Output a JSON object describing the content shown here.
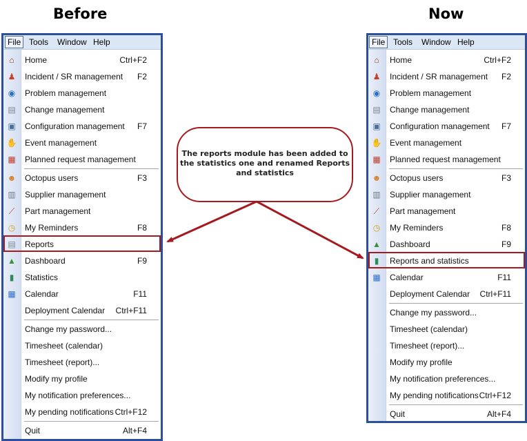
{
  "headings": {
    "before": "Before",
    "now": "Now"
  },
  "menubar": [
    "File",
    "Tools",
    "Window",
    "Help"
  ],
  "callout": "The reports module has been added to the statistics one and renamed Reports and statistics",
  "before_menu": [
    {
      "label": "Home",
      "shortcut": "Ctrl+F2",
      "icon": "home-icon"
    },
    {
      "label": "Incident / SR management",
      "shortcut": "F2",
      "icon": "incident-icon"
    },
    {
      "label": "Problem management",
      "shortcut": "",
      "icon": "problem-icon"
    },
    {
      "label": "Change management",
      "shortcut": "",
      "icon": "change-icon"
    },
    {
      "label": "Configuration management",
      "shortcut": "F7",
      "icon": "configuration-icon"
    },
    {
      "label": "Event management",
      "shortcut": "",
      "icon": "event-icon"
    },
    {
      "label": "Planned request management",
      "shortcut": "",
      "icon": "calendar-12-icon"
    },
    {
      "sep": true
    },
    {
      "label": "Octopus users",
      "shortcut": "F3",
      "icon": "users-icon"
    },
    {
      "label": "Supplier management",
      "shortcut": "",
      "icon": "supplier-icon"
    },
    {
      "label": "Part management",
      "shortcut": "",
      "icon": "part-icon"
    },
    {
      "label": "My Reminders",
      "shortcut": "F8",
      "icon": "reminder-icon"
    },
    {
      "label": "Reports",
      "shortcut": "",
      "icon": "report-icon",
      "highlight": true
    },
    {
      "label": "Dashboard",
      "shortcut": "F9",
      "icon": "dashboard-icon"
    },
    {
      "label": "Statistics",
      "shortcut": "",
      "icon": "statistics-icon"
    },
    {
      "label": "Calendar",
      "shortcut": "F11",
      "icon": "calendar-icon"
    },
    {
      "label": "Deployment Calendar",
      "shortcut": "Ctrl+F11",
      "icon": ""
    },
    {
      "sep": true
    },
    {
      "label": "Change my password...",
      "shortcut": "",
      "icon": ""
    },
    {
      "label": "Timesheet (calendar)",
      "shortcut": "",
      "icon": ""
    },
    {
      "label": "Timesheet (report)...",
      "shortcut": "",
      "icon": ""
    },
    {
      "label": "Modify my profile",
      "shortcut": "",
      "icon": ""
    },
    {
      "label": "My notification preferences...",
      "shortcut": "",
      "icon": ""
    },
    {
      "label": "My pending notifications",
      "shortcut": "Ctrl+F12",
      "icon": ""
    },
    {
      "sep": true
    },
    {
      "label": "Quit",
      "shortcut": "Alt+F4",
      "icon": ""
    }
  ],
  "now_menu": [
    {
      "label": "Home",
      "shortcut": "Ctrl+F2",
      "icon": "home-icon"
    },
    {
      "label": "Incident / SR management",
      "shortcut": "F2",
      "icon": "incident-icon"
    },
    {
      "label": "Problem management",
      "shortcut": "",
      "icon": "problem-icon"
    },
    {
      "label": "Change management",
      "shortcut": "",
      "icon": "change-icon"
    },
    {
      "label": "Configuration management",
      "shortcut": "F7",
      "icon": "configuration-icon"
    },
    {
      "label": "Event management",
      "shortcut": "",
      "icon": "event-icon"
    },
    {
      "label": "Planned request management",
      "shortcut": "",
      "icon": "calendar-12-icon"
    },
    {
      "sep": true
    },
    {
      "label": "Octopus users",
      "shortcut": "F3",
      "icon": "users-icon"
    },
    {
      "label": "Supplier management",
      "shortcut": "",
      "icon": "supplier-icon"
    },
    {
      "label": "Part management",
      "shortcut": "",
      "icon": "part-icon"
    },
    {
      "label": "My Reminders",
      "shortcut": "F8",
      "icon": "reminder-icon"
    },
    {
      "label": "Dashboard",
      "shortcut": "F9",
      "icon": "dashboard-icon"
    },
    {
      "label": "Reports and statistics",
      "shortcut": "",
      "icon": "statistics-icon",
      "highlight": true
    },
    {
      "label": "Calendar",
      "shortcut": "F11",
      "icon": "calendar-icon"
    },
    {
      "label": "Deployment Calendar",
      "shortcut": "Ctrl+F11",
      "icon": ""
    },
    {
      "sep": true
    },
    {
      "label": "Change my password...",
      "shortcut": "",
      "icon": ""
    },
    {
      "label": "Timesheet (calendar)",
      "shortcut": "",
      "icon": ""
    },
    {
      "label": "Timesheet (report)...",
      "shortcut": "",
      "icon": ""
    },
    {
      "label": "Modify my profile",
      "shortcut": "",
      "icon": ""
    },
    {
      "label": "My notification preferences...",
      "shortcut": "",
      "icon": ""
    },
    {
      "label": "My pending notifications",
      "shortcut": "Ctrl+F12",
      "icon": ""
    },
    {
      "sep": true
    },
    {
      "label": "Quit",
      "shortcut": "Alt+F4",
      "icon": ""
    }
  ],
  "colors": {
    "window_border": "#2b4f9a",
    "highlight": "#a51a1f",
    "menubar": "#dce7f6"
  }
}
